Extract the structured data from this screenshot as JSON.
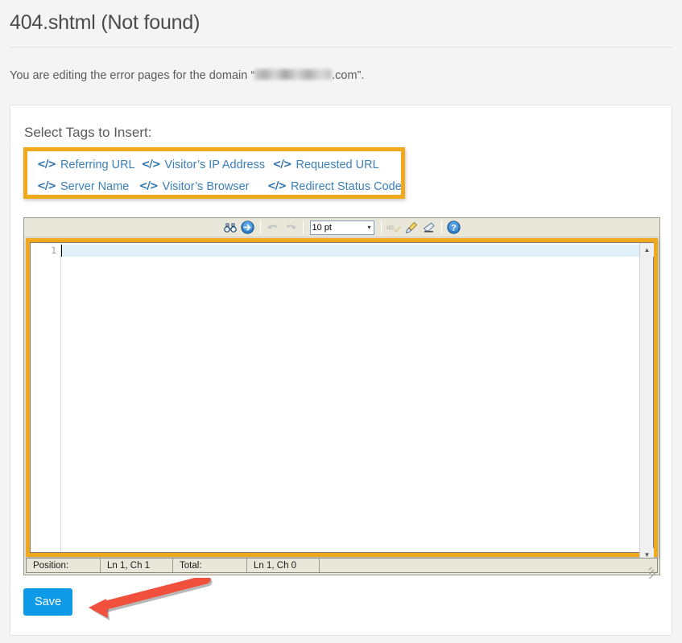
{
  "header": {
    "title": "404.shtml (Not found)",
    "intro_prefix": "You are editing the error pages for the domain “",
    "intro_domain_redacted": "",
    "intro_suffix": ".com”."
  },
  "card": {
    "section_label": "Select Tags to Insert:",
    "tags": [
      {
        "icon": "code-icon",
        "label": "Referring URL"
      },
      {
        "icon": "code-icon",
        "label": "Visitor’s IP Address"
      },
      {
        "icon": "code-icon",
        "label": "Requested URL"
      },
      {
        "icon": "code-icon",
        "label": "Server Name"
      },
      {
        "icon": "code-icon",
        "label": "Visitor’s Browser"
      },
      {
        "icon": "code-icon",
        "label": "Redirect Status Code"
      }
    ],
    "save_label": "Save"
  },
  "editor": {
    "toolbar": {
      "find_icon": "binoculars-icon",
      "goto_icon": "goto-arrow-icon",
      "undo_icon": "undo-icon",
      "redo_icon": "redo-icon",
      "font_size_value": "10 pt",
      "font_size_caret": "▼",
      "spellcheck_icon": "spellcheck-icon",
      "highlight_icon": "paintbrush-icon",
      "eraser_icon": "eraser-icon",
      "help_icon": "help-icon"
    },
    "gutter_line_numbers": [
      "1"
    ],
    "content": "",
    "scroll_up_glyph": "▲",
    "scroll_down_glyph": "▼",
    "status_bar": {
      "position_label": "Position:",
      "position_value": "Ln 1, Ch 1",
      "total_label": "Total:",
      "total_value": "Ln 1, Ch 0"
    }
  },
  "colors": {
    "page_background": "#f4f4f4",
    "card_background": "#ffffff",
    "highlight_border": "#f0a81d",
    "link_blue": "#3b7fb8",
    "save_blue": "#0f9ae8",
    "annotation_red": "#f0503c",
    "toolbar_beige": "#e9e6da",
    "current_line_blue": "#e2f0f7"
  }
}
